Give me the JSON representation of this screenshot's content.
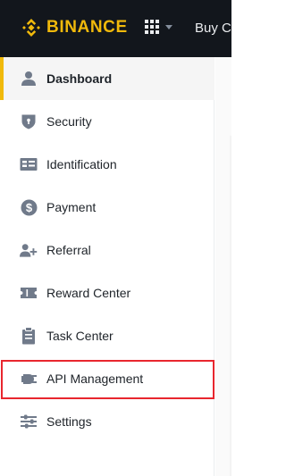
{
  "header": {
    "brand": "BINANCE",
    "buy_crypto_label": "Buy Crypto",
    "accent_color": "#f0b90b",
    "background_color": "#12161c"
  },
  "sidebar": {
    "active_item": "Dashboard",
    "highlighted_item": "API Management",
    "highlight_color": "#e8262e",
    "items": [
      {
        "label": "Dashboard",
        "icon": "user-icon"
      },
      {
        "label": "Security",
        "icon": "shield-icon"
      },
      {
        "label": "Identification",
        "icon": "id-card-icon"
      },
      {
        "label": "Payment",
        "icon": "dollar-circle-icon"
      },
      {
        "label": "Referral",
        "icon": "user-plus-icon"
      },
      {
        "label": "Reward Center",
        "icon": "ticket-icon"
      },
      {
        "label": "Task Center",
        "icon": "clipboard-icon"
      },
      {
        "label": "API Management",
        "icon": "api-plug-icon"
      },
      {
        "label": "Settings",
        "icon": "sliders-icon"
      }
    ]
  }
}
